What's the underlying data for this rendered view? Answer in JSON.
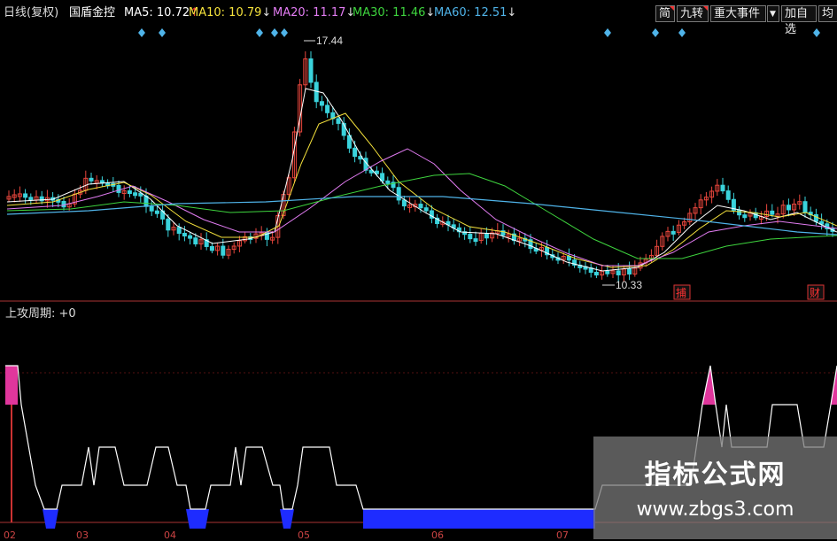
{
  "header": {
    "period": "日线(复权)",
    "stock": "国盾金控",
    "ma5": {
      "label": "MA5:",
      "value": "10.72",
      "arrow": "↑",
      "color": "#ffffff"
    },
    "ma10": {
      "label": "MA10:",
      "value": "10.79",
      "arrow": "↓",
      "color": "#f5e23c"
    },
    "ma20": {
      "label": "MA20:",
      "value": "11.17",
      "arrow": "↓",
      "color": "#e27cf2"
    },
    "ma30": {
      "label": "MA30:",
      "value": "11.46",
      "arrow": "↓",
      "color": "#3ed43e"
    },
    "ma60": {
      "label": "MA60:",
      "value": "12.51",
      "arrow": "↓",
      "color": "#4fb3e8"
    }
  },
  "toolbar": {
    "jian": "简",
    "jiuzhuan": "九转",
    "zhongda": "重大事件",
    "dropdown": "▼",
    "addwatch": "加自选",
    "cut": "均线"
  },
  "chart": {
    "high_label": "17.44",
    "low_label": "10.33",
    "mark_bu": "捕",
    "mark_cai": "财"
  },
  "indicator": {
    "title": "上攻周期: +0"
  },
  "xaxis": {
    "labels": [
      "02",
      "03",
      "04",
      "05",
      "06",
      "07"
    ]
  },
  "watermark": {
    "line1": "指标公式网",
    "line2": "www.zbgs3.com"
  },
  "colors": {
    "up": "#e8463c",
    "down": "#3ad3dc",
    "bg": "#000000",
    "ind_line": "#ffffff",
    "ind_fill_blue": "#1e2cff",
    "ind_fill_pink": "#e0369c"
  }
}
